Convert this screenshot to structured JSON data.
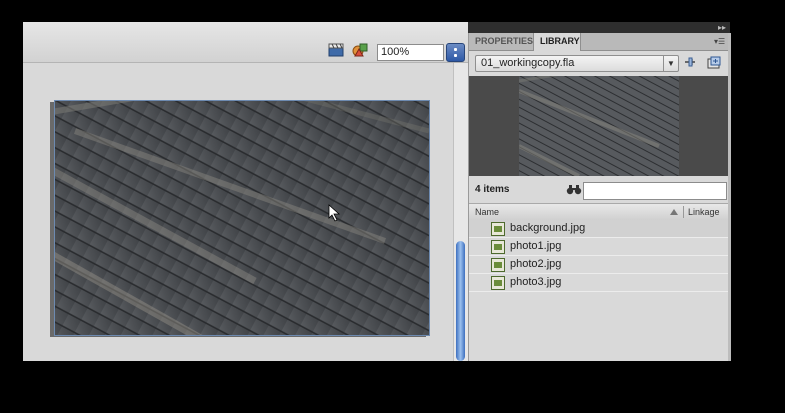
{
  "toolbar": {
    "zoom_value": "100%"
  },
  "panel": {
    "tabs": [
      {
        "label": "PROPERTIES",
        "active": false
      },
      {
        "label": "LIBRARY",
        "active": true
      }
    ],
    "document_select": "01_workingcopy.fla",
    "items_count": "4 items",
    "search_value": "",
    "columns": {
      "name": "Name",
      "linkage": "Linkage"
    },
    "items": [
      {
        "label": "background.jpg",
        "selected": true
      },
      {
        "label": "photo1.jpg",
        "selected": false
      },
      {
        "label": "photo2.jpg",
        "selected": false
      },
      {
        "label": "photo3.jpg",
        "selected": false
      }
    ]
  },
  "icons": {
    "edit_scene": "clapper-icon",
    "edit_symbol": "symbol-icon",
    "zoom_menu": "stepper-icon",
    "new_symbol": "pin-icon",
    "new_folder": "new-library-icon",
    "search": "binoculars-icon",
    "item": "bitmap-icon",
    "panel_menu": "panel-menu-icon"
  },
  "colors": {
    "accent": "#2d58a6",
    "panel_bg": "#d9d9d9",
    "selection": "#d1d1d1"
  }
}
